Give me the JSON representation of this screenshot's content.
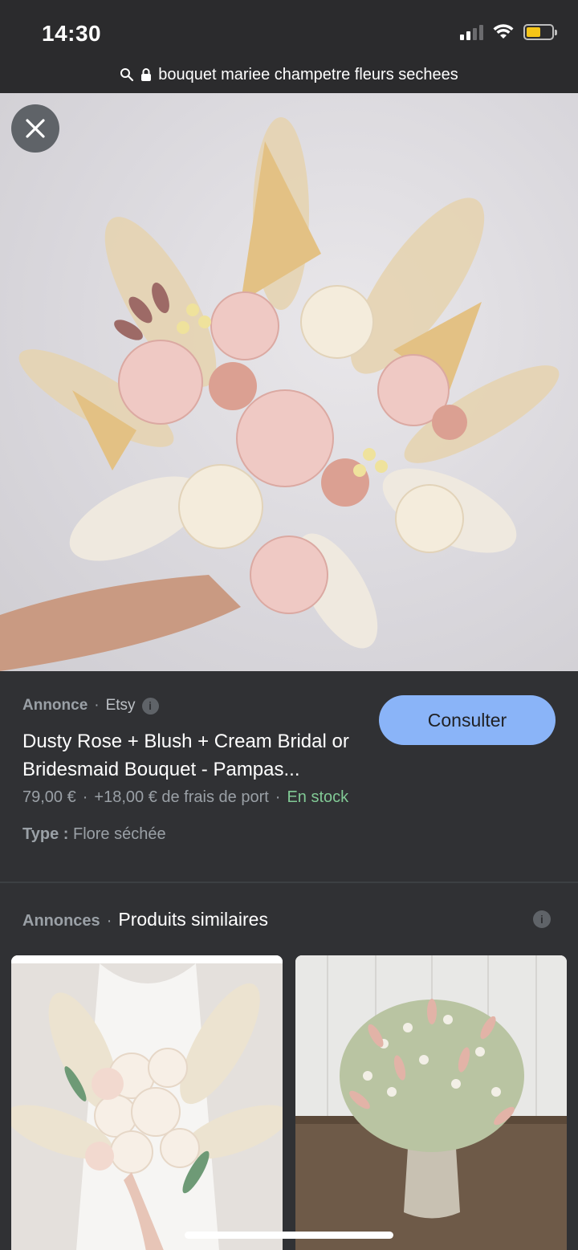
{
  "status_bar": {
    "time": "14:30",
    "battery_color": "#f5c518"
  },
  "url_bar": {
    "text": "bouquet mariee champetre fleurs sechees",
    "search_icon": "search-icon",
    "lock_icon": "lock-icon"
  },
  "viewer": {
    "close_icon": "close-icon"
  },
  "product": {
    "ad_label": "Annonce",
    "separator": "·",
    "merchant": "Etsy",
    "info_glyph": "i",
    "title": "Dusty Rose + Blush + Cream Bridal or Bridesmaid Bouquet - Pampas...",
    "price": "79,00 €",
    "shipping": "+18,00 € de frais de port",
    "stock": "En stock",
    "type_label": "Type :",
    "type_value": "Flore séchée",
    "cta_label": "Consulter",
    "cta_color": "#8ab4f8",
    "stock_color": "#81c995"
  },
  "similar": {
    "ads_label": "Annonces",
    "separator": "·",
    "title": "Produits similaires",
    "info_glyph": "i"
  }
}
